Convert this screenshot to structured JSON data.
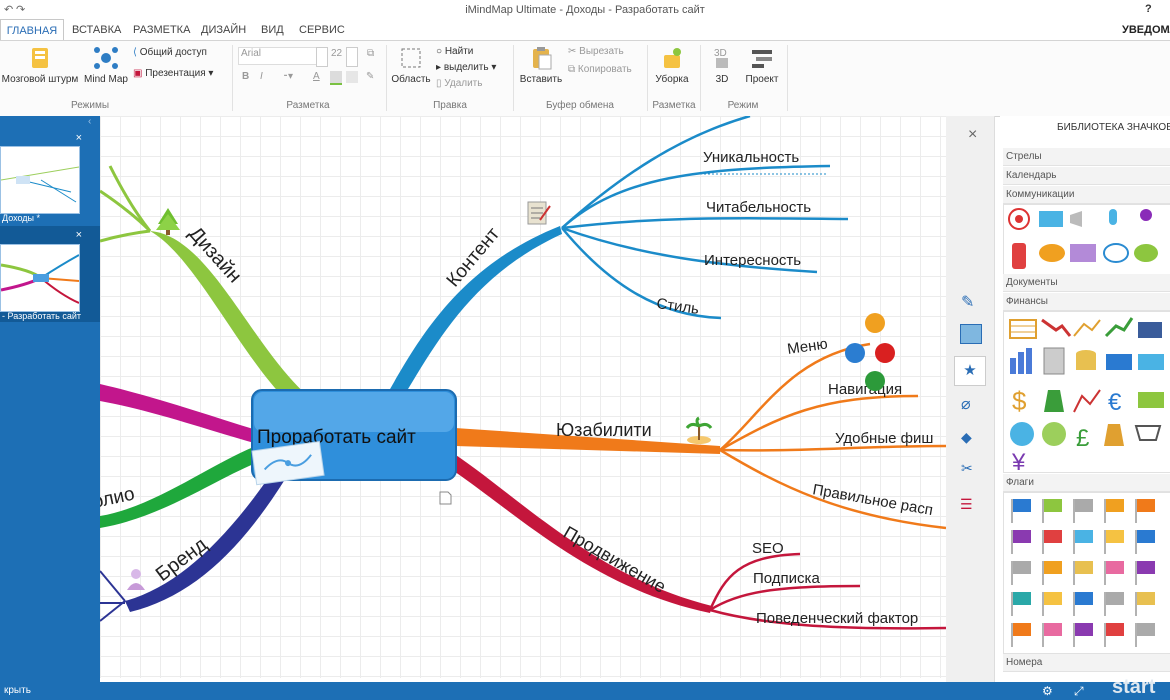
{
  "window": {
    "title": "iMindMap Ultimate - Доходы - Разработать сайт",
    "notifications": "УВЕДОМЛ",
    "help": "?"
  },
  "tabs": [
    "ГЛАВНАЯ",
    "ВСТАВКА",
    "РАЗМЕТКА",
    "ДИЗАЙН",
    "ВИД",
    "СЕРВИС"
  ],
  "ribbon": {
    "modes": {
      "brainstorm": "Мозговой штурм",
      "mindmap": "Mind Map",
      "share": "Общий доступ",
      "present": "Презентация",
      "group": "Режимы"
    },
    "format": {
      "font": "Arial",
      "size": "22",
      "group": "Разметка"
    },
    "edit": {
      "area": "Область",
      "find": "Найти",
      "select": "выделить",
      "delete": "Удалить",
      "group": "Правка"
    },
    "clipboard": {
      "paste": "Вставить",
      "cut": "Вырезать",
      "copy": "Копировать",
      "group": "Буфер обмена"
    },
    "layout": {
      "tidy": "Уборка",
      "group": "Разметка"
    },
    "mode": {
      "d3": "3D",
      "project": "Проект",
      "group": "Режим",
      "d3_icon": "3D"
    }
  },
  "left_panel": {
    "maps": [
      {
        "caption": "Доходы *"
      },
      {
        "caption": "- Разработать сайт"
      }
    ],
    "close": "×"
  },
  "mindmap": {
    "central": "Проработать сайт",
    "branches": {
      "content": "Контент",
      "design": "Дизайн",
      "usability": "Юзабилити",
      "promotion": "Продвижение",
      "brand": "Бренд",
      "portfolio": "олио"
    },
    "content_subs": [
      "Уникальность",
      "Читабельность",
      "Интересность",
      "Стиль"
    ],
    "usability_subs": [
      "Меню",
      "Навигация",
      "Удобные фиш",
      "Правильное расп"
    ],
    "promotion_subs": [
      "SEO",
      "Подписка",
      "Поведенческий фактор"
    ]
  },
  "library": {
    "title": "БИБЛИОТЕКА ЗНАЧКОВ",
    "categories": [
      "Стрелы",
      "Календарь",
      "Коммуникации",
      "Документы",
      "Финансы",
      "Флаги",
      "Номера"
    ],
    "close": "×"
  },
  "status": {
    "left": "крыть",
    "watermark": "start"
  },
  "colors": {
    "accent": "#1d6fb5",
    "content": "#1b8bc9",
    "design": "#8dc63f",
    "usability": "#f07a1a",
    "promotion": "#c4163c",
    "brand": "#2c3494",
    "portfolio": "#1fa83c",
    "magenta": "#c2168c"
  }
}
